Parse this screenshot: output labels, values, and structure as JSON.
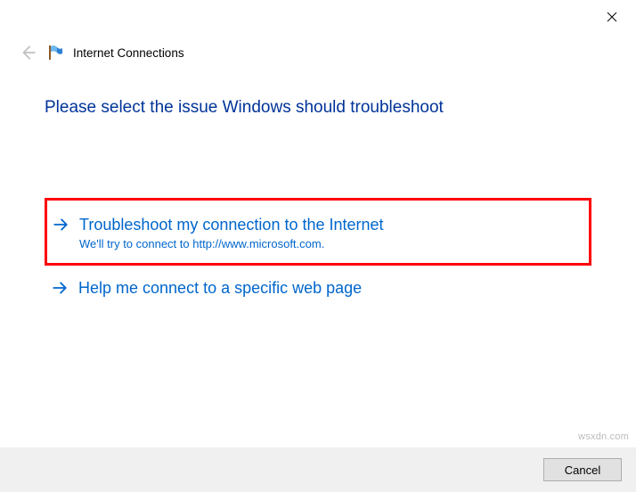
{
  "window": {
    "title": "Internet Connections"
  },
  "main": {
    "heading": "Please select the issue Windows should troubleshoot"
  },
  "options": [
    {
      "title": "Troubleshoot my connection to the Internet",
      "sub": "We'll try to connect to http://www.microsoft.com."
    },
    {
      "title": "Help me connect to a specific web page",
      "sub": ""
    }
  ],
  "footer": {
    "cancel": "Cancel"
  },
  "watermark": "wsxdn.com"
}
